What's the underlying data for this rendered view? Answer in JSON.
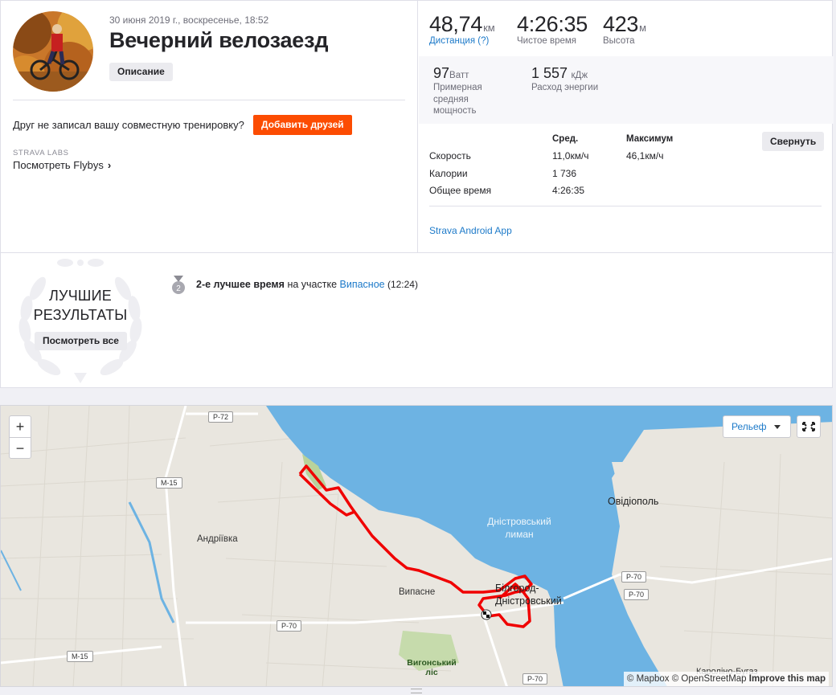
{
  "activity": {
    "date": "30 июня 2019 г., воскресенье, 18:52",
    "title": "Вечерний велозаезд",
    "description_button": "Описание",
    "friend_question": "Друг не записал вашу совместную тренировку?",
    "add_friends_button": "Добавить друзей",
    "labs_label": "STRAVA LABS",
    "flybys_link": "Посмотреть Flybys"
  },
  "stats": {
    "distance": {
      "value": "48,74",
      "unit": "км",
      "label": "Дистанция (?)"
    },
    "moving_time": {
      "value": "4:26:35",
      "label": "Чистое время"
    },
    "elevation": {
      "value": "423",
      "unit": "м",
      "label": "Высота"
    },
    "power": {
      "value": "97",
      "unit": "Ватт",
      "label": "Примерная средняя мощность"
    },
    "energy": {
      "value": "1 557",
      "unit": "кДж",
      "label": "Расход энергии"
    }
  },
  "details_table": {
    "headers": [
      "Сред.",
      "Максимум"
    ],
    "rows": [
      {
        "label": "Скорость",
        "avg": "11,0км/ч",
        "max": "46,1км/ч"
      },
      {
        "label": "Калории",
        "avg": "1 736",
        "max": ""
      },
      {
        "label": "Общее время",
        "avg": "4:26:35",
        "max": ""
      }
    ],
    "collapse_button": "Свернуть"
  },
  "device_link": "Strava Android App",
  "best_results": {
    "title_line1": "ЛУЧШИЕ",
    "title_line2": "РЕЗУЛЬТАТЫ",
    "view_all_button": "Посмотреть все",
    "medal_rank": "2",
    "achievement_bold": "2-е лучшее время",
    "achievement_mid": " на участке ",
    "segment_name": "Випасное",
    "segment_time": " (12:24)"
  },
  "map": {
    "zoom_in": "+",
    "zoom_out": "−",
    "style_button": "Рельеф",
    "attribution_mapbox": "© Mapbox",
    "attribution_osm": "© OpenStreetMap",
    "improve_link": "Improve this map",
    "labels": {
      "ovidiopol": "Овідіополь",
      "andriivka": "Андріївка",
      "vypasne": "Випасне",
      "city_line1": "Білгород-",
      "city_line2": "Дністровський",
      "liman_line1": "Дністровський",
      "liman_line2": "лиман",
      "forest_line1": "Вигонський",
      "forest_line2": "ліс",
      "karolino": "Кароліно-Бугаз"
    },
    "roads": {
      "r72": "Р-72",
      "m15_a": "М-15",
      "m15_b": "М-15",
      "r70_a": "Р-70",
      "r70_b": "Р-70",
      "r70_c": "Р-70",
      "r70_d": "Р-70"
    },
    "colors": {
      "water": "#6db3e3",
      "route": "#f00000",
      "land": "#e9e6df"
    }
  }
}
